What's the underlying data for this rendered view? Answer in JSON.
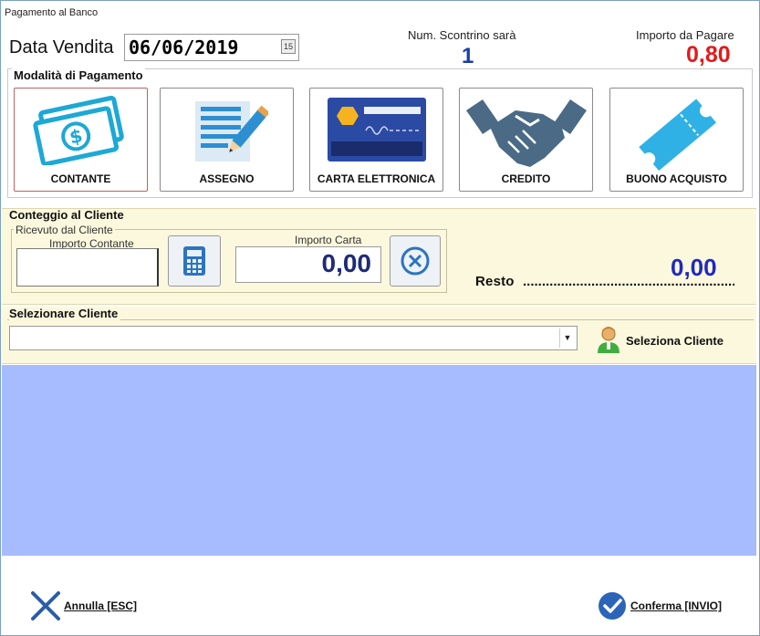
{
  "window": {
    "title": "Pagamento al Banco"
  },
  "header": {
    "data_label": "Data Vendita",
    "data_value": "06/06/2019",
    "scontrino_label": "Num. Scontrino sarà",
    "scontrino_value": "1",
    "importo_label": "Importo da Pagare",
    "importo_value": "0,80",
    "importo_color": "#e21b1b"
  },
  "payment": {
    "legend": "Modalità di Pagamento",
    "methods": [
      {
        "label": "CONTANTE",
        "icon": "cash-icon",
        "selected": true
      },
      {
        "label": "ASSEGNO",
        "icon": "check-icon",
        "selected": false
      },
      {
        "label": "CARTA ELETTRONICA",
        "icon": "credit-card-icon",
        "selected": false
      },
      {
        "label": "CREDITO",
        "icon": "handshake-icon",
        "selected": false
      },
      {
        "label": "BUONO ACQUISTO",
        "icon": "ticket-icon",
        "selected": false
      }
    ]
  },
  "conteggio": {
    "title": "Conteggio al Cliente",
    "ricevuto_label": "Ricevuto dal Cliente",
    "importo_contante_label": "Importo Contante",
    "importo_contante_value": "",
    "importo_carta_label": "Importo Carta",
    "importo_carta_value": "0,00",
    "resto_label": "Resto",
    "resto_value": "0,00"
  },
  "cliente": {
    "title": "Selezionare Cliente",
    "select_value": "",
    "button_label": "Seleziona Cliente"
  },
  "footer": {
    "annulla_label": "Annulla [ESC]",
    "conferma_label": "Conferma [INVIO]"
  },
  "colors": {
    "blue_area": "#a7bbff",
    "panel": "#fbf8dd",
    "accent_blue": "#1f2ac0"
  }
}
